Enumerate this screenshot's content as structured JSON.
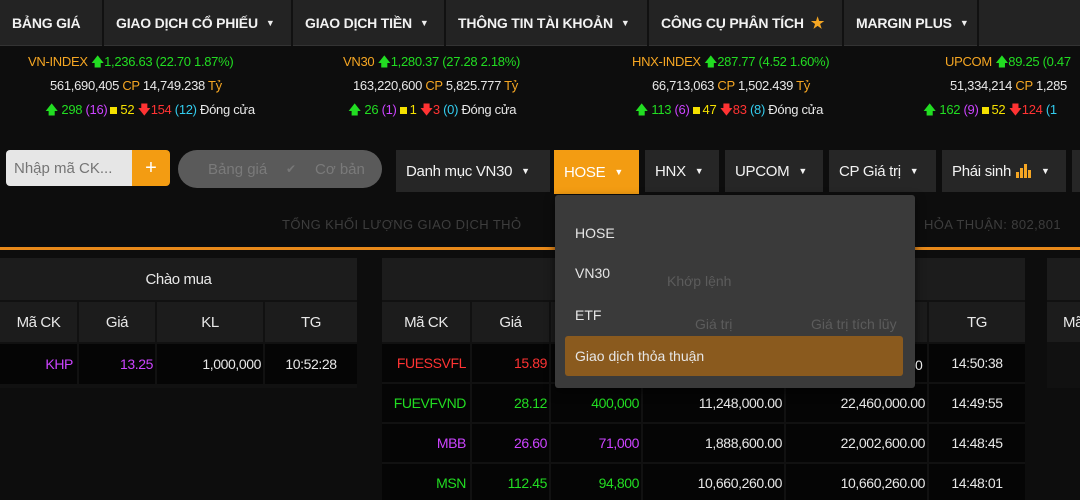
{
  "nav": {
    "items": [
      {
        "label": "BẢNG GIÁ",
        "caret": false
      },
      {
        "label": "GIAO DỊCH CỔ PHIẾU",
        "caret": true
      },
      {
        "label": "GIAO DỊCH TIỀN",
        "caret": true
      },
      {
        "label": "THÔNG TIN TÀI KHOẢN",
        "caret": true
      },
      {
        "label": "CÔNG CỤ PHÂN TÍCH",
        "caret": false,
        "star": true
      },
      {
        "label": "MARGIN PLUS",
        "caret": true
      }
    ]
  },
  "indices": [
    {
      "name": "VN-INDEX",
      "value": "1,236.63",
      "change": "(22.70 1.87%)",
      "volume": "561,690,405",
      "cp": "CP",
      "amount": "14,749.238",
      "unit": "Tỷ",
      "up": "298",
      "ceil": "(16)",
      "flat": "52",
      "down": "154",
      "floor": "(12)",
      "status": "Đóng cửa"
    },
    {
      "name": "VN30",
      "value": "1,280.37",
      "change": "(27.28 2.18%)",
      "volume": "163,220,600",
      "cp": "CP",
      "amount": "5,825.777",
      "unit": "Tỷ",
      "up": "26",
      "ceil": "(1)",
      "flat": "1",
      "down": "3",
      "floor": "(0)",
      "status": "Đóng cửa"
    },
    {
      "name": "HNX-INDEX",
      "value": "287.77",
      "change": "(4.52 1.60%)",
      "volume": "66,713,063",
      "cp": "CP",
      "amount": "1,502.439",
      "unit": "Tỷ",
      "up": "113",
      "ceil": "(6)",
      "flat": "47",
      "down": "83",
      "floor": "(8)",
      "status": "Đóng cửa"
    },
    {
      "name": "UPCOM",
      "value": "89.25",
      "change": "(0.47",
      "volume": "51,334,214",
      "cp": "CP",
      "amount": "1,285",
      "unit": "",
      "up": "162",
      "ceil": "(9)",
      "flat": "52",
      "down": "124",
      "floor": "(1",
      "status": ""
    }
  ],
  "toolbar": {
    "search_placeholder": "Nhập mã CK...",
    "toggle_opt1": "Bảng giá",
    "toggle_opt2": "Cơ bản",
    "dropdowns": [
      "Danh mục VN30",
      "HOSE",
      "HNX",
      "UPCOM",
      "CP Giá trị",
      "Phái sinh"
    ],
    "active_dropdown": "HOSE"
  },
  "subtext_left": "TỔNG KHỐI LƯỢNG GIAO DỊCH THỎ",
  "subtext_right": "HỎA THUẬN: 802,801",
  "bid_table": {
    "title": "Chào mua",
    "headers": [
      "Mã CK",
      "Giá",
      "KL",
      "TG"
    ],
    "rows": [
      {
        "code": "KHP",
        "price": "13.25",
        "vol": "1,000,000",
        "time": "10:52:28"
      }
    ]
  },
  "match_table": {
    "headers": [
      "Mã CK",
      "Giá",
      "",
      "",
      "",
      "TG"
    ],
    "rows": [
      {
        "code": "FUESSVFL",
        "price": "15.89",
        "vol": "",
        "value": "",
        "accum": "",
        "time": "14:50:38"
      },
      {
        "code": "FUEVFVND",
        "price": "28.12",
        "vol": "400,000",
        "value": "11,248,000.00",
        "accum": "22,460,000.00",
        "time": "14:49:55"
      },
      {
        "code": "MBB",
        "price": "26.60",
        "vol": "71,000",
        "value": "1,888,600.00",
        "accum": "22,002,600.00",
        "time": "14:48:45"
      },
      {
        "code": "MSN",
        "price": "112.45",
        "vol": "94,800",
        "value": "10,660,260.00",
        "accum": "10,660,260.00",
        "time": "14:48:01"
      }
    ]
  },
  "right_table": {
    "header": "Mã"
  },
  "menu": {
    "items": [
      "HOSE",
      "VN30",
      "ETF",
      "Giao dịch thỏa thuận"
    ],
    "ghost_title": "Khớp lệnh",
    "ghost_col1": "Giá trị",
    "ghost_col2": "Giá trị tích lũy",
    "ghost_time": "0"
  },
  "colors": {
    "accent": "#f39c12",
    "up": "#22dd22",
    "down": "#ff3333",
    "ceiling": "#cc44ff",
    "floor": "#33ccee",
    "ref": "#f5e100"
  }
}
